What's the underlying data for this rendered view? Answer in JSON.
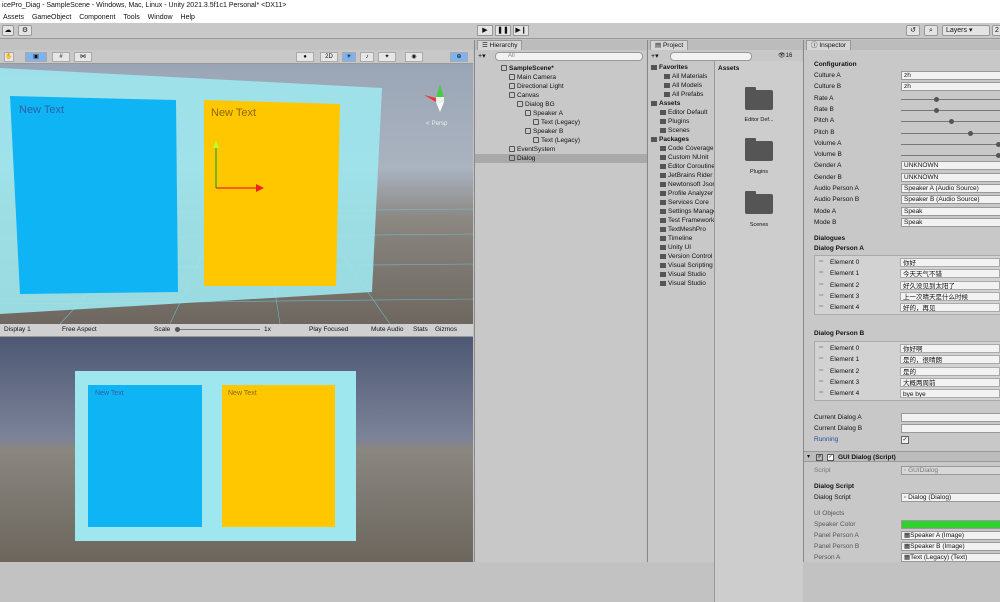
{
  "window": {
    "title": "icePro_Diag - SampleScene - Windows, Mac, Linux - Unity 2021.3.5f1c1 Personal* <DX11>"
  },
  "menu": [
    "Assets",
    "GameObject",
    "Component",
    "Tools",
    "Window",
    "Help"
  ],
  "toolbar": {
    "play": "▶",
    "pause": "❚❚",
    "step": "▶❙",
    "layers": "Layers",
    "layout": "2"
  },
  "scene": {
    "text_left": "New Text",
    "text_right": "New Text",
    "persp": "≺ Persp",
    "mode_2d": "2D"
  },
  "gamebar": {
    "display": "Display 1",
    "aspect": "Free Aspect",
    "scale_label": "Scale",
    "scale_val": "1x",
    "play_focused": "Play Focused",
    "mute": "Mute Audio",
    "stats": "Stats",
    "gizmos": "Gizmos"
  },
  "game": {
    "text_left": "New Text",
    "text_right": "New Text"
  },
  "hierarchy": {
    "tab": "Hierarchy",
    "search_placeholder": "All",
    "items": [
      {
        "label": "SampleScene*",
        "indent": 0,
        "bold": true
      },
      {
        "label": "Main Camera",
        "indent": 1
      },
      {
        "label": "Directional Light",
        "indent": 1
      },
      {
        "label": "Canvas",
        "indent": 1
      },
      {
        "label": "Dialog BG",
        "indent": 2
      },
      {
        "label": "Speaker A",
        "indent": 3
      },
      {
        "label": "Text (Legacy)",
        "indent": 4
      },
      {
        "label": "Speaker B",
        "indent": 3
      },
      {
        "label": "Text (Legacy)",
        "indent": 4
      },
      {
        "label": "EventSystem",
        "indent": 1
      },
      {
        "label": "Dialog",
        "indent": 1,
        "selected": true
      }
    ]
  },
  "project": {
    "tab": "Project",
    "count": "16",
    "favorites_label": "Favorites",
    "favorites": [
      "All Materials",
      "All Models",
      "All Prefabs"
    ],
    "assets_label": "Assets",
    "assets": [
      "Editor Default",
      "Plugins",
      "Scenes"
    ],
    "packages_label": "Packages",
    "packages": [
      "Code Coverage",
      "Custom NUnit",
      "Editor Coroutines",
      "JetBrains Rider",
      "Newtonsoft Json",
      "Profile Analyzer",
      "Services Core",
      "Settings Manager",
      "Test Framework",
      "TextMeshPro",
      "Timeline",
      "Unity UI",
      "Version Control",
      "Visual Scripting",
      "Visual Studio",
      "Visual Studio"
    ],
    "grid_header": "Assets",
    "grid": [
      "Editor Def...",
      "Plugins",
      "Scenes"
    ]
  },
  "inspector": {
    "tab": "Inspector",
    "config_label": "Configuration",
    "props": [
      {
        "label": "Culture A",
        "value": "zh"
      },
      {
        "label": "Culture B",
        "value": "zh"
      },
      {
        "label": "Rate A",
        "slider": 0.35
      },
      {
        "label": "Rate B",
        "slider": 0.35
      },
      {
        "label": "Pitch A",
        "slider": 0.5
      },
      {
        "label": "Pitch B",
        "slider": 0.7
      },
      {
        "label": "Volume A",
        "slider": 1.0
      },
      {
        "label": "Volume B",
        "slider": 1.0
      },
      {
        "label": "Gender A",
        "value": "UNKNOWN"
      },
      {
        "label": "Gender B",
        "value": "UNKNOWN"
      },
      {
        "label": "Audio Person A",
        "value": "Speaker A (Audio Source)"
      },
      {
        "label": "Audio Person B",
        "value": "Speaker B (Audio Source)"
      },
      {
        "label": "Mode A",
        "value": "Speak"
      },
      {
        "label": "Mode B",
        "value": "Speak"
      }
    ],
    "dialogues_label": "Dialogues",
    "person_a_label": "Dialog Person A",
    "person_a": [
      {
        "label": "Element 0",
        "value": "你好"
      },
      {
        "label": "Element 1",
        "value": "今天天气不错"
      },
      {
        "label": "Element 2",
        "value": "好久没见到太阳了"
      },
      {
        "label": "Element 3",
        "value": "上一次晴天是什么时候"
      },
      {
        "label": "Element 4",
        "value": "好的，再见"
      }
    ],
    "person_b_label": "Dialog Person B",
    "person_b": [
      {
        "label": "Element 0",
        "value": "你好啊"
      },
      {
        "label": "Element 1",
        "value": "是的，很晴朗"
      },
      {
        "label": "Element 2",
        "value": "是的"
      },
      {
        "label": "Element 3",
        "value": "大概两周前"
      },
      {
        "label": "Element 4",
        "value": "bye bye"
      }
    ],
    "current_a": "Current Dialog A",
    "current_b": "Current Dialog B",
    "running": "Running",
    "component": "GUI Dialog (Script)",
    "script_label": "Script",
    "script_value": "GUIDialog",
    "dialog_script_header": "Dialog Script",
    "dialog_script_label": "Dialog Script",
    "dialog_script_value": "Dialog (Dialog)",
    "ui_objects": "UI Objects",
    "speaker_color": "Speaker Color",
    "panel_a": "Panel Person A",
    "panel_a_val": "Speaker A (Image)",
    "panel_b": "Panel Person B",
    "panel_b_val": "Speaker B (Image)",
    "person_a_text": "Person A",
    "person_a_text_val": "Text (Legacy) (Text)"
  },
  "colors": {
    "blue": "#0fb4f5",
    "yellow": "#ffc700",
    "canvas": "#9ee7ee",
    "accent": "#1e4fa0"
  }
}
